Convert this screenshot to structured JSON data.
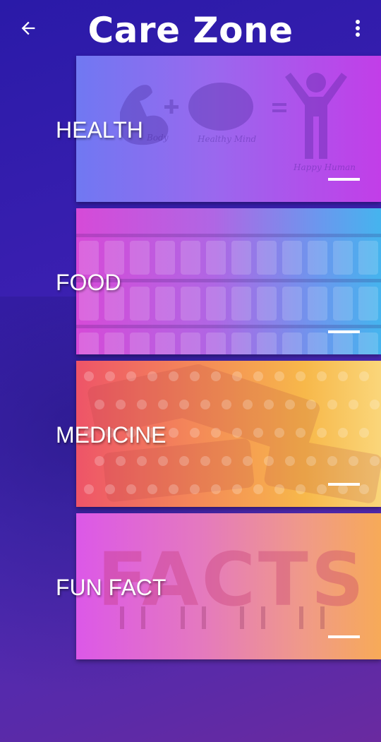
{
  "header": {
    "title": "Care Zone",
    "back_icon": "arrow-left-icon",
    "menu_icon": "more-vert-icon"
  },
  "cards": [
    {
      "label": "HEALTH",
      "art_texts": [
        "Body",
        "Healthy Mind",
        "Happy Human"
      ],
      "colors": [
        "#7078f2",
        "#c23ee8"
      ]
    },
    {
      "label": "FOOD",
      "colors": [
        "#d64ad8",
        "#45b4ee"
      ]
    },
    {
      "label": "MEDICINE",
      "colors": [
        "#ee5468",
        "#fad67a"
      ]
    },
    {
      "label": "FUN FACT",
      "art_text": "FACTS",
      "colors": [
        "#dc58e8",
        "#f7aa58"
      ]
    }
  ],
  "colors": {
    "background_start": "#2a1aa8",
    "background_end": "#6a2aa0",
    "text": "#ffffff"
  }
}
